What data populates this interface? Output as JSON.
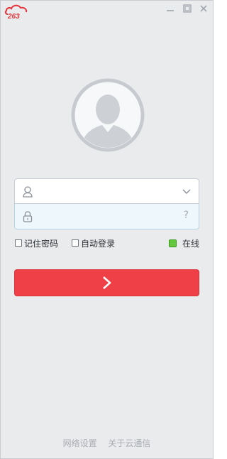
{
  "window": {
    "brand_logo_text": "263",
    "controls": {
      "minimize": "minimize-icon",
      "maximize": "maximize-icon",
      "close": "close-icon"
    }
  },
  "avatar": {
    "icon": "user-avatar-icon"
  },
  "username": {
    "value": "",
    "placeholder": "",
    "icon": "user-icon",
    "dropdown_icon": "chevron-down-icon"
  },
  "password": {
    "value": "",
    "placeholder": "",
    "icon": "lock-icon",
    "help_text": "?"
  },
  "options": {
    "remember_password": {
      "label": "记住密码",
      "checked": false
    },
    "auto_login": {
      "label": "自动登录",
      "checked": false
    },
    "status": {
      "label": "在线",
      "color": "#62c73c"
    }
  },
  "login_button": {
    "icon": "arrow-right-icon",
    "color": "#ef4048"
  },
  "footer": {
    "network_settings": "网络设置",
    "about": "关于云通信"
  }
}
